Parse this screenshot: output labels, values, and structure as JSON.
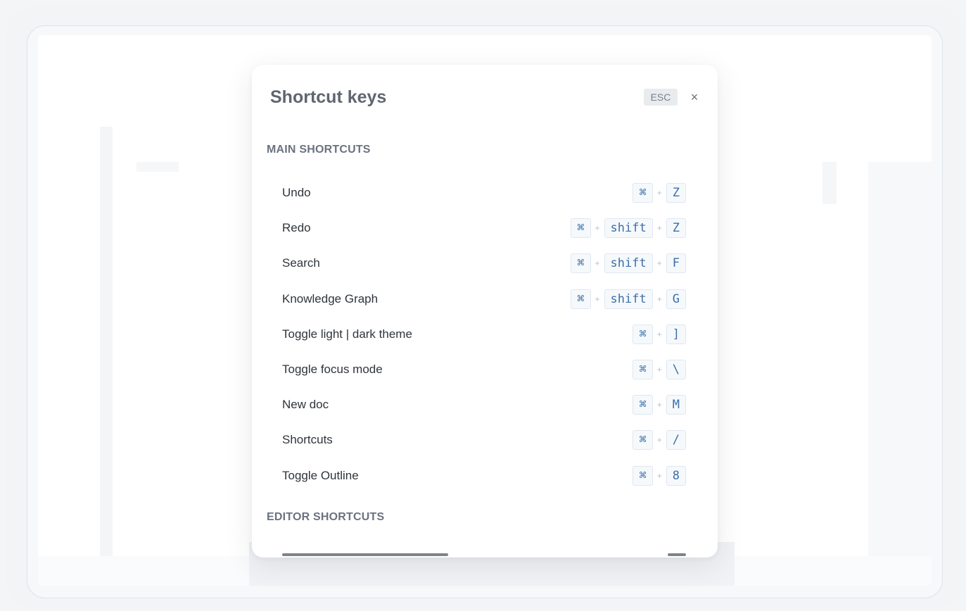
{
  "modal": {
    "title": "Shortcut keys",
    "esc_label": "ESC",
    "close_glyph": "×"
  },
  "sections": [
    {
      "title": "MAIN SHORTCUTS",
      "rows": [
        {
          "label": "Undo",
          "keys": [
            "⌘",
            "Z"
          ]
        },
        {
          "label": "Redo",
          "keys": [
            "⌘",
            "shift",
            "Z"
          ]
        },
        {
          "label": "Search",
          "keys": [
            "⌘",
            "shift",
            "F"
          ]
        },
        {
          "label": "Knowledge Graph",
          "keys": [
            "⌘",
            "shift",
            "G"
          ]
        },
        {
          "label": "Toggle light | dark theme",
          "keys": [
            "⌘",
            "]"
          ]
        },
        {
          "label": "Toggle focus mode",
          "keys": [
            "⌘",
            "\\"
          ]
        },
        {
          "label": "New doc",
          "keys": [
            "⌘",
            "M"
          ]
        },
        {
          "label": "Shortcuts",
          "keys": [
            "⌘",
            "/"
          ]
        },
        {
          "label": "Toggle Outline",
          "keys": [
            "⌘",
            "8"
          ]
        }
      ]
    },
    {
      "title": "EDITOR SHORTCUTS",
      "rows": []
    }
  ],
  "key_separator": "+",
  "icons": {
    "close": "close-icon"
  },
  "colors": {
    "key_text": "#3c6fa7",
    "key_bg": "#f6f9fc",
    "title": "#5f6670"
  }
}
